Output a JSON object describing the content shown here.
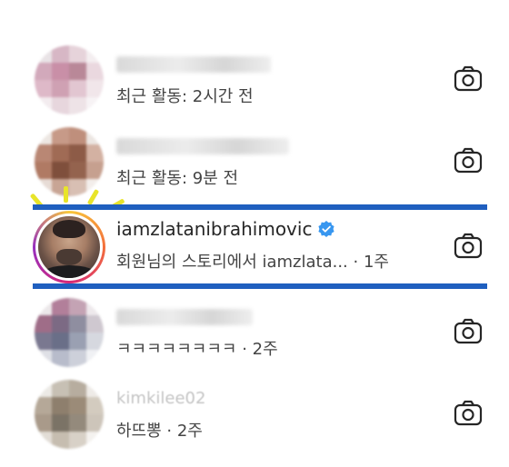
{
  "rows": [
    {
      "subtitle": "최근 활동: 2시간 전"
    },
    {
      "subtitle": "최근 활동: 9분 전"
    },
    {
      "name": "iamzlatanibrahimovic",
      "subtitle": "회원님의 스토리에서 iamzlata... · 1주",
      "verified": true
    },
    {
      "subtitle": "ㅋㅋㅋㅋㅋㅋㅋㅋ · 2주"
    },
    {
      "name": "kimkilee02",
      "subtitle": "하뜨뽕 · 2주"
    }
  ],
  "colors": {
    "highlight": "#1f5fbf",
    "verified": "#3897f0",
    "spark": "#e8e42a"
  },
  "icons": {
    "row_action": "camera-icon",
    "badge": "verified-badge-icon"
  }
}
